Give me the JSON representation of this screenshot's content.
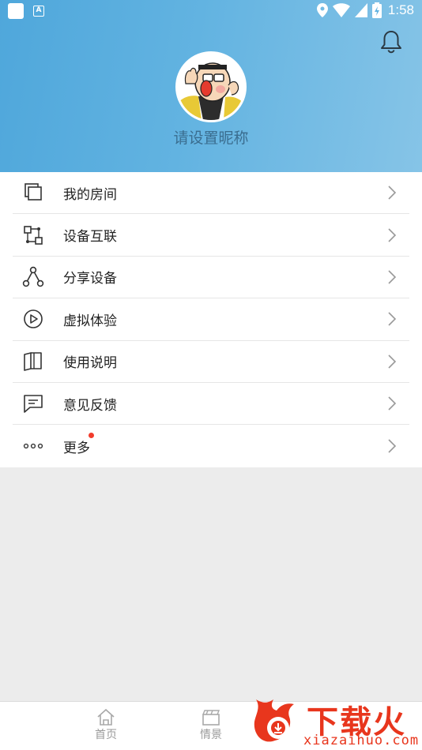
{
  "status_bar": {
    "time": "1:58"
  },
  "header": {
    "nickname": "请设置昵称"
  },
  "menu": {
    "items": [
      {
        "label": "我的房间",
        "icon": "rooms-icon"
      },
      {
        "label": "设备互联",
        "icon": "device-link-icon"
      },
      {
        "label": "分享设备",
        "icon": "share-icon"
      },
      {
        "label": "虚拟体验",
        "icon": "play-icon"
      },
      {
        "label": "使用说明",
        "icon": "manual-icon"
      },
      {
        "label": "意见反馈",
        "icon": "feedback-icon"
      },
      {
        "label": "更多",
        "icon": "more-icon",
        "badge": "red-dot"
      }
    ]
  },
  "bottom_nav": {
    "tabs": [
      {
        "label": "首页",
        "icon": "home-icon"
      },
      {
        "label": "情景",
        "icon": "scene-icon"
      }
    ]
  },
  "watermark": {
    "title": "下载火",
    "site": "xiazaihuo.com"
  },
  "colors": {
    "header_start": "#4fa7db",
    "header_end": "#86c4e7",
    "badge": "#f23c2c",
    "watermark": "#e8361d"
  }
}
